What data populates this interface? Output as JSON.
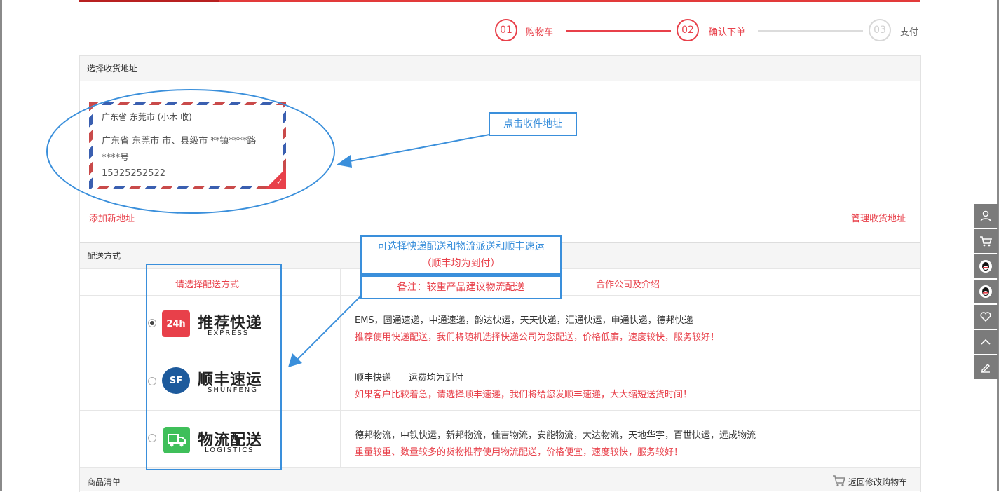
{
  "steps": [
    {
      "num": "01",
      "label": "购物车"
    },
    {
      "num": "02",
      "label": "确认下单"
    },
    {
      "num": "03",
      "label": "支付"
    }
  ],
  "address": {
    "section_title": "选择收货地址",
    "card_name": "广东省 东莞市 (小木 收)",
    "card_addr": "广东省 东莞市 市、县级市 **镇****路****号",
    "card_phone": "15325252522",
    "add_new": "添加新地址",
    "manage": "管理收货地址"
  },
  "shipping": {
    "section_title": "配送方式",
    "col_select": "请选择配送方式",
    "col_partners": "合作公司及介绍",
    "options": [
      {
        "logo_title": "推荐快递",
        "logo_sub": "EXPRESS",
        "logo_badge": "24h",
        "logo_color": "#e8404a",
        "selected": true,
        "companies": "EMS，圆通速递，中通速递，韵达快运，天天快递，汇通快运，申通快递，德邦快递",
        "desc": "推荐使用快递配送，我们将随机选择快递公司为您配送，价格低廉，速度较快，服务较好！"
      },
      {
        "logo_title": "顺丰速运",
        "logo_sub": "SHUNFENG",
        "logo_badge": "SF",
        "logo_color": "#1d5a9c",
        "selected": false,
        "companies": "顺丰快递      运费均为到付",
        "desc": "如果客户比较着急，请选择顺丰速递，我们将给您发顺丰速递，大大缩短送货时间！"
      },
      {
        "logo_title": "物流配送",
        "logo_sub": "LOGISTICS",
        "logo_badge": "",
        "logo_color": "#3fbf5a",
        "selected": false,
        "companies": "德邦物流，中铁快运，新邦物流，佳吉物流，安能物流，大达物流，天地华宇，百世快运，远成物流",
        "desc": "重量较重、数量较多的货物推荐使用物流配送，价格便宜，速度较快，服务较好！"
      }
    ]
  },
  "goods": {
    "section_title": "商品清单",
    "back_to_cart": "返回修改购物车"
  },
  "annotations": {
    "click_address": "点击收件地址",
    "shipping_note_line1": "可选择快递配送和物流派送和顺丰速运",
    "shipping_note_line2": "（顺丰均为到付）",
    "remark": "备注：较重产品建议物流配送"
  },
  "sidebar_icons": [
    "user-icon",
    "cart-icon",
    "qq-icon",
    "qq-icon",
    "heart-icon",
    "chevron-up-icon",
    "edit-icon"
  ],
  "colors": {
    "accent": "#e8404a",
    "annotation": "#3a8fdb",
    "sidebar": "#7b7b7b"
  }
}
